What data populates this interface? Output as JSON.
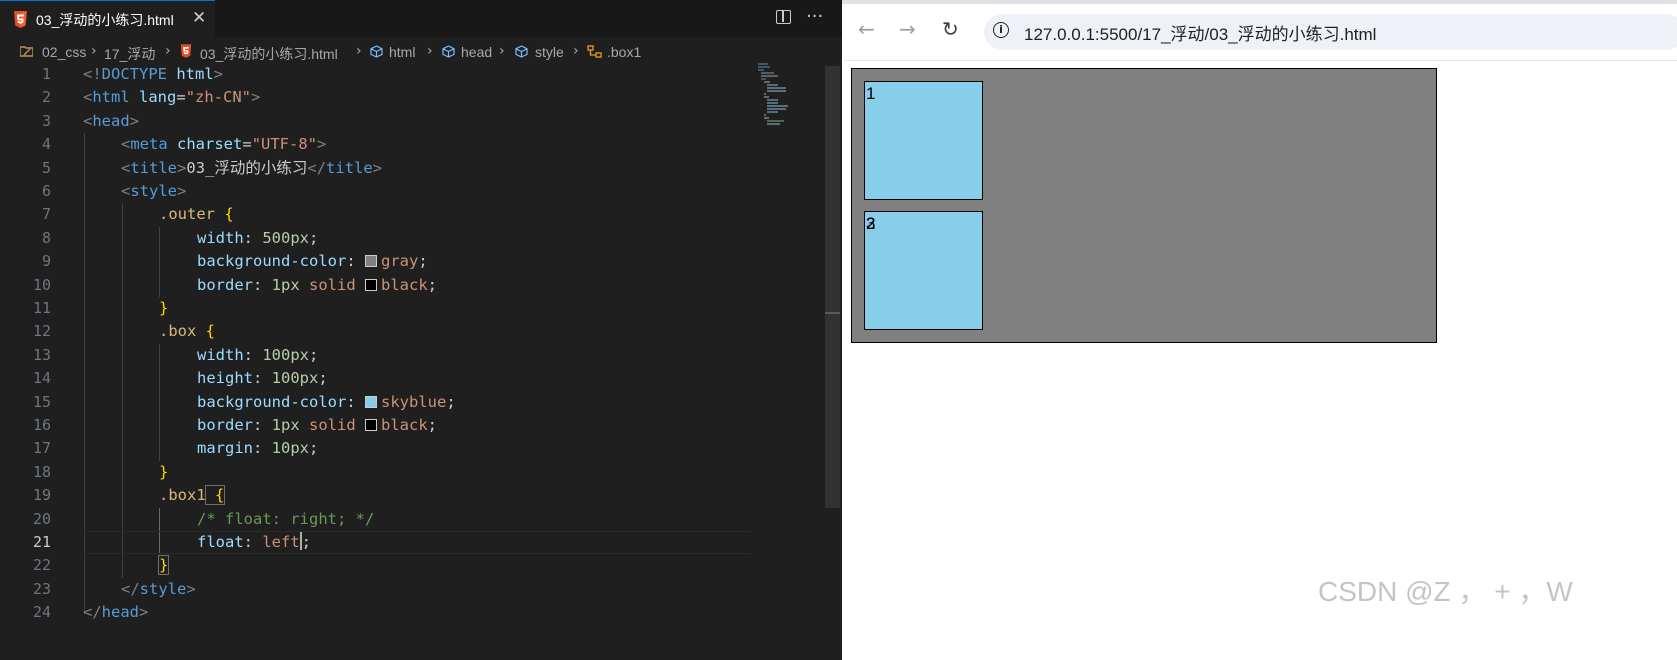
{
  "editor": {
    "tab": {
      "filename": "03_浮动的小练习.html",
      "close_glyph": "✕"
    },
    "breadcrumb": [
      "02_css",
      "17_浮动",
      "03_浮动的小练习.html",
      "html",
      "head",
      "style",
      ".box1"
    ],
    "line_numbers": [
      "1",
      "2",
      "3",
      "4",
      "5",
      "6",
      "7",
      "8",
      "9",
      "10",
      "11",
      "12",
      "13",
      "14",
      "15",
      "16",
      "17",
      "18",
      "19",
      "20",
      "21",
      "22",
      "23",
      "24"
    ],
    "active_line": "21",
    "code": {
      "l1": {
        "open": "<!",
        "doctype": "DOCTYPE",
        "sp": " ",
        "html": "html",
        "close": ">"
      },
      "l2": {
        "open": "<",
        "tag": "html",
        "sp": " ",
        "attr": "lang",
        "eq": "=",
        "val": "\"zh-CN\"",
        "close": ">"
      },
      "l3": {
        "open": "<",
        "tag": "head",
        "close": ">"
      },
      "l4": {
        "open": "<",
        "tag": "meta",
        "sp": " ",
        "attr": "charset",
        "eq": "=",
        "val": "\"UTF-8\"",
        "close": ">"
      },
      "l5": {
        "open": "<",
        "tag": "title",
        "close": ">",
        "text": "03_浮动的小练习",
        "open2": "</",
        "tag2": "title",
        "close2": ">"
      },
      "l6": {
        "open": "<",
        "tag": "style",
        "close": ">"
      },
      "l7": {
        "selector": ".outer",
        "brace": " {"
      },
      "l8": {
        "prop": "width",
        "colon": ": ",
        "num": "500px",
        "semi": ";"
      },
      "l9": {
        "prop": "background-color",
        "colon": ": ",
        "val": "gray",
        "semi": ";",
        "swatch": "#808080"
      },
      "l10": {
        "prop": "border",
        "colon": ": ",
        "num": "1px",
        "kw": " solid ",
        "val": "black",
        "semi": ";",
        "swatch": "#000000"
      },
      "l11": {
        "brace": "}"
      },
      "l12": {
        "selector": ".box",
        "brace": " {"
      },
      "l13": {
        "prop": "width",
        "colon": ": ",
        "num": "100px",
        "semi": ";"
      },
      "l14": {
        "prop": "height",
        "colon": ": ",
        "num": "100px",
        "semi": ";"
      },
      "l15": {
        "prop": "background-color",
        "colon": ": ",
        "val": "skyblue",
        "semi": ";",
        "swatch": "#87ceeb"
      },
      "l16": {
        "prop": "border",
        "colon": ": ",
        "num": "1px",
        "kw": " solid ",
        "val": "black",
        "semi": ";",
        "swatch": "#000000"
      },
      "l17": {
        "prop": "margin",
        "colon": ": ",
        "num": "10px",
        "semi": ";"
      },
      "l18": {
        "brace": "}"
      },
      "l19": {
        "selector": ".box1",
        "brace": " {"
      },
      "l20": {
        "comment": "/* float: right; */"
      },
      "l21": {
        "prop": "float",
        "colon": ": ",
        "val": "left",
        "semi": ";"
      },
      "l22": {
        "brace": "}"
      },
      "l23": {
        "open": "</",
        "tag": "style",
        "close": ">"
      },
      "l24": {
        "open": "</",
        "tag": "head",
        "close": ">"
      }
    }
  },
  "browser": {
    "url": "127.0.0.1:5500/17_浮动/03_浮动的小练习.html",
    "info_glyph": "i",
    "back_glyph": "←",
    "forward_glyph": "→",
    "reload_glyph": "↻",
    "page": {
      "box1_label": "1",
      "box_lower_label_a": "2",
      "box_lower_label_b": "3"
    },
    "colors": {
      "outer_bg": "#808080",
      "box_bg": "#87ceeb",
      "border": "#000000"
    }
  },
  "watermark": "CSDN @Z ， + ，W"
}
